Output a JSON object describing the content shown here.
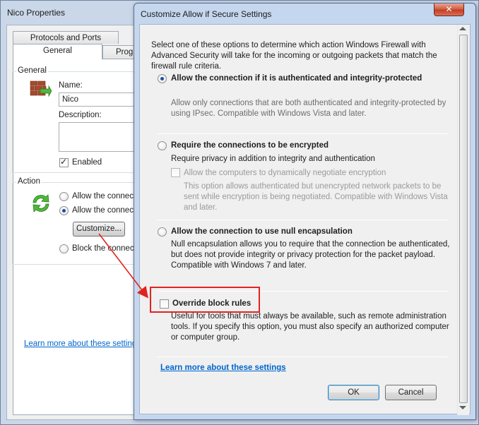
{
  "back_window": {
    "title": "Nico Properties",
    "tabs": {
      "protocols": "Protocols and Ports",
      "general": "General",
      "programs": "Progr"
    },
    "general_group": "General",
    "name_label": "Name:",
    "name_value": "Nico",
    "description_label": "Description:",
    "enabled_label": "Enabled",
    "action_group": "Action",
    "radio_allow": "Allow the connecti",
    "radio_secure": "Allow the connecti",
    "customize_button": "Customize...",
    "radio_block": "Block the connecti",
    "learn_link": "Learn more about these settings"
  },
  "dialog": {
    "title": "Customize Allow if Secure Settings",
    "close_symbol": "✕",
    "intro": "Select one of these options to determine which action Windows Firewall with Advanced Security will take for the incoming or outgoing packets that match the firewall rule criteria.",
    "option1": {
      "label": "Allow the connection if it is authenticated and integrity-protected",
      "desc": "Allow only connections that are both authenticated and integrity-protected by using IPsec. Compatible with Windows Vista and later.",
      "selected": true
    },
    "option2": {
      "label": "Require the connections to be encrypted",
      "desc": "Require privacy in addition to integrity and authentication",
      "sub_checkbox": "Allow the computers to dynamically negotiate encryption",
      "sub_desc": "This option allows authenticated but unencrypted network packets to be sent while encryption is being negotiated. Compatible with Windows Vista and later."
    },
    "option3": {
      "label": "Allow the connection to use null encapsulation",
      "desc": "Null encapsulation allows you to require that the connection be authenticated, but does not provide integrity or privacy protection for the packet payload. Compatible with Windows 7 and later."
    },
    "override": {
      "label": "Override block rules",
      "desc": "Useful for tools that must always be available, such as remote administration tools. If you specify this option, you must also specify an authorized computer or computer group."
    },
    "learn_link": "Learn more about these settings",
    "ok_button": "OK",
    "cancel_button": "Cancel"
  },
  "colors": {
    "annotation_red": "#e1231f",
    "link_blue": "#0066cc",
    "title_bar": "#c5d7ee"
  }
}
